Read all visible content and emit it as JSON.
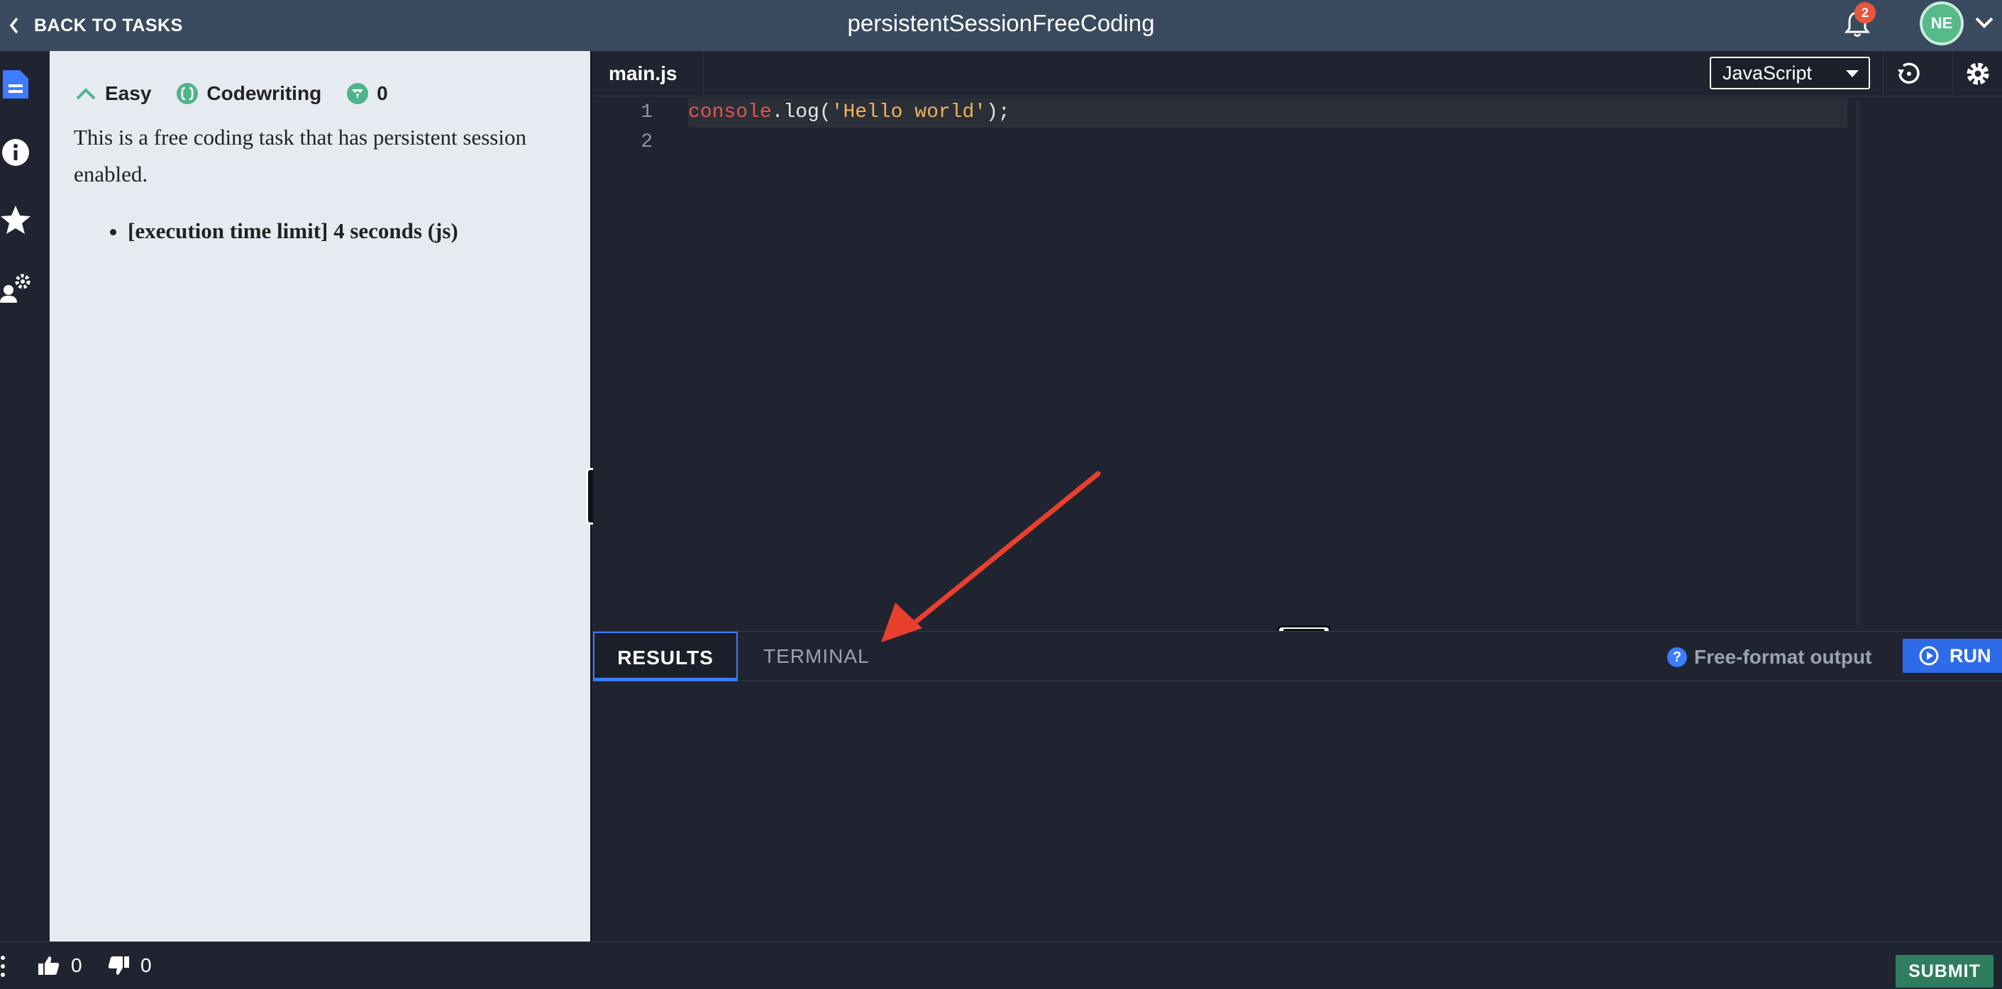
{
  "header": {
    "back_label": "BACK TO TASKS",
    "title": "persistentSessionFreeCoding",
    "notifications_count": "2",
    "avatar_initials": "NE"
  },
  "sidebar": {
    "items": [
      {
        "name": "description",
        "icon": "document-icon"
      },
      {
        "name": "info",
        "icon": "info-icon"
      },
      {
        "name": "favorite",
        "icon": "star-icon"
      },
      {
        "name": "settings",
        "icon": "user-gear-icon"
      }
    ]
  },
  "task": {
    "difficulty": "Easy",
    "type": "Codewriting",
    "score": "0",
    "description": "This is a free coding task that has persistent session enabled.",
    "constraints": [
      "[execution time limit] 4 seconds (js)"
    ]
  },
  "editor": {
    "file_tab": "main.js",
    "language": "JavaScript",
    "lines": [
      {
        "number": "1",
        "obj": "console",
        "rest1": ".log(",
        "str": "'Hello world'",
        "rest2": ");"
      },
      {
        "number": "2"
      }
    ]
  },
  "results": {
    "tab_results": "RESULTS",
    "tab_terminal": "TERMINAL",
    "output_mode": "Free-format output",
    "run_label": "RUN"
  },
  "footer": {
    "likes": "0",
    "dislikes": "0",
    "submit_label": "SUBMIT"
  },
  "colors": {
    "accent_blue": "#2d6be9",
    "submit_green": "#2f7d5f",
    "annotation_red": "#e8402e"
  }
}
